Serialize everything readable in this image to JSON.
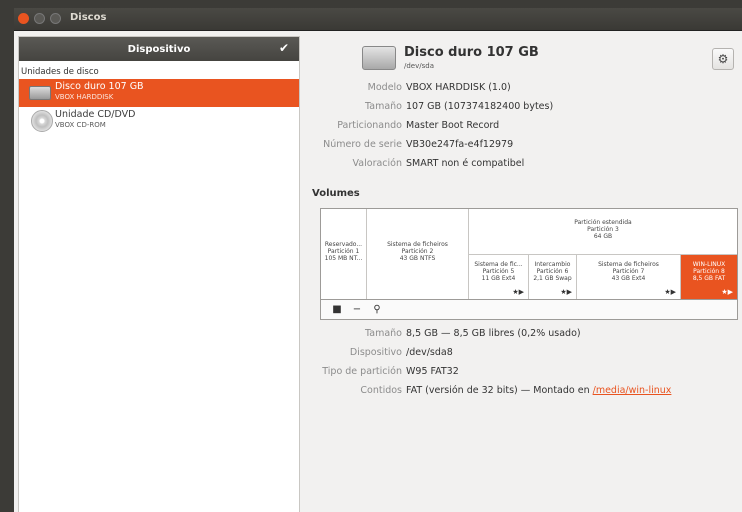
{
  "window": {
    "title": "Discos"
  },
  "sidebar": {
    "header": "Dispositivo",
    "group_label": "Unidades de disco",
    "items": [
      {
        "name": "Disco duro 107 GB",
        "sub": "VBOX HARDDISK",
        "icon": "hard-disk-icon",
        "selected": true
      },
      {
        "name": "Unidade CD/DVD",
        "sub": "VBOX CD-ROM",
        "icon": "optical-disc-icon",
        "selected": false
      }
    ]
  },
  "disk": {
    "title": "Disco duro 107 GB",
    "device": "/dev/sda",
    "fields": [
      {
        "key": "Modelo",
        "value": "VBOX HARDDISK (1.0)"
      },
      {
        "key": "Tamaño",
        "value": "107 GB (107374182400 bytes)"
      },
      {
        "key": "Particionando",
        "value": "Master Boot Record"
      },
      {
        "key": "Número de serie",
        "value": "VB30e247fa-e4f12979"
      },
      {
        "key": "Valoración",
        "value": "SMART non é compatibel"
      }
    ]
  },
  "volumes": {
    "title": "Volumes",
    "top": [
      {
        "l1": "Reservado...",
        "l2": "Partición 1",
        "l3": "105 MB NT..."
      },
      {
        "l1": "Sistema de ficheiros",
        "l2": "Partición 2",
        "l3": "43 GB NTFS"
      },
      {
        "l1": "Partición estendida",
        "l2": "Partición 3",
        "l3": "64 GB"
      }
    ],
    "bottom": [
      {
        "l1": "Sistema de fic...",
        "l2": "Partición 5",
        "l3": "11 GB Ext4"
      },
      {
        "l1": "Intercambio",
        "l2": "Partición 6",
        "l3": "2,1 GB Swap"
      },
      {
        "l1": "Sistema de ficheiros",
        "l2": "Partición 7",
        "l3": "43 GB Ext4"
      },
      {
        "l1": "WIN-LINUX",
        "l2": "Partición 8",
        "l3": "8,5 GB FAT"
      }
    ]
  },
  "partition": {
    "fields": [
      {
        "key": "Tamaño",
        "value": "8,5 GB — 8,5 GB libres (0,2% usado)"
      },
      {
        "key": "Dispositivo",
        "value": "/dev/sda8"
      },
      {
        "key": "Tipo de partición",
        "value": "W95 FAT32"
      }
    ],
    "contents_key": "Contidos",
    "contents_value": "FAT (versión de 32 bits) — Montado en ",
    "mount_link": "/media/win-linux"
  },
  "colors": {
    "accent": "#e95420",
    "titlebar": "#3c3b37"
  }
}
